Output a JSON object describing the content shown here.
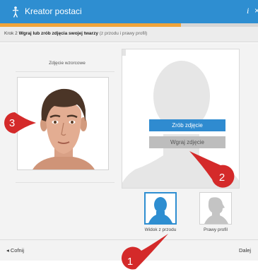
{
  "window": {
    "title": "Kreator postaci",
    "info_symbol": "i",
    "close_symbol": "×"
  },
  "progress": {
    "fraction": 0.7
  },
  "step": {
    "prefix": "Krok 2",
    "instruction": "Wgraj lub zrób zdjęcia swojej twarzy",
    "hint": "(z przodu i prawy profil)"
  },
  "reference": {
    "label": "Zdjęcie wzorcowe"
  },
  "actions": {
    "take_photo": "Zrób zdjęcie",
    "upload_photo": "Wgraj zdjęcie"
  },
  "views": [
    {
      "label": "Widok z przodu",
      "selected": true
    },
    {
      "label": "Prawy profil",
      "selected": false
    }
  ],
  "footer": {
    "back": "Cofnij",
    "next": "Dalej",
    "back_icon": "chevron-left-icon"
  },
  "annotations": [
    "1",
    "2",
    "3"
  ],
  "colors": {
    "accent": "#2e8ed1",
    "progress": "#f0a43a",
    "marker": "#d42a2a"
  }
}
